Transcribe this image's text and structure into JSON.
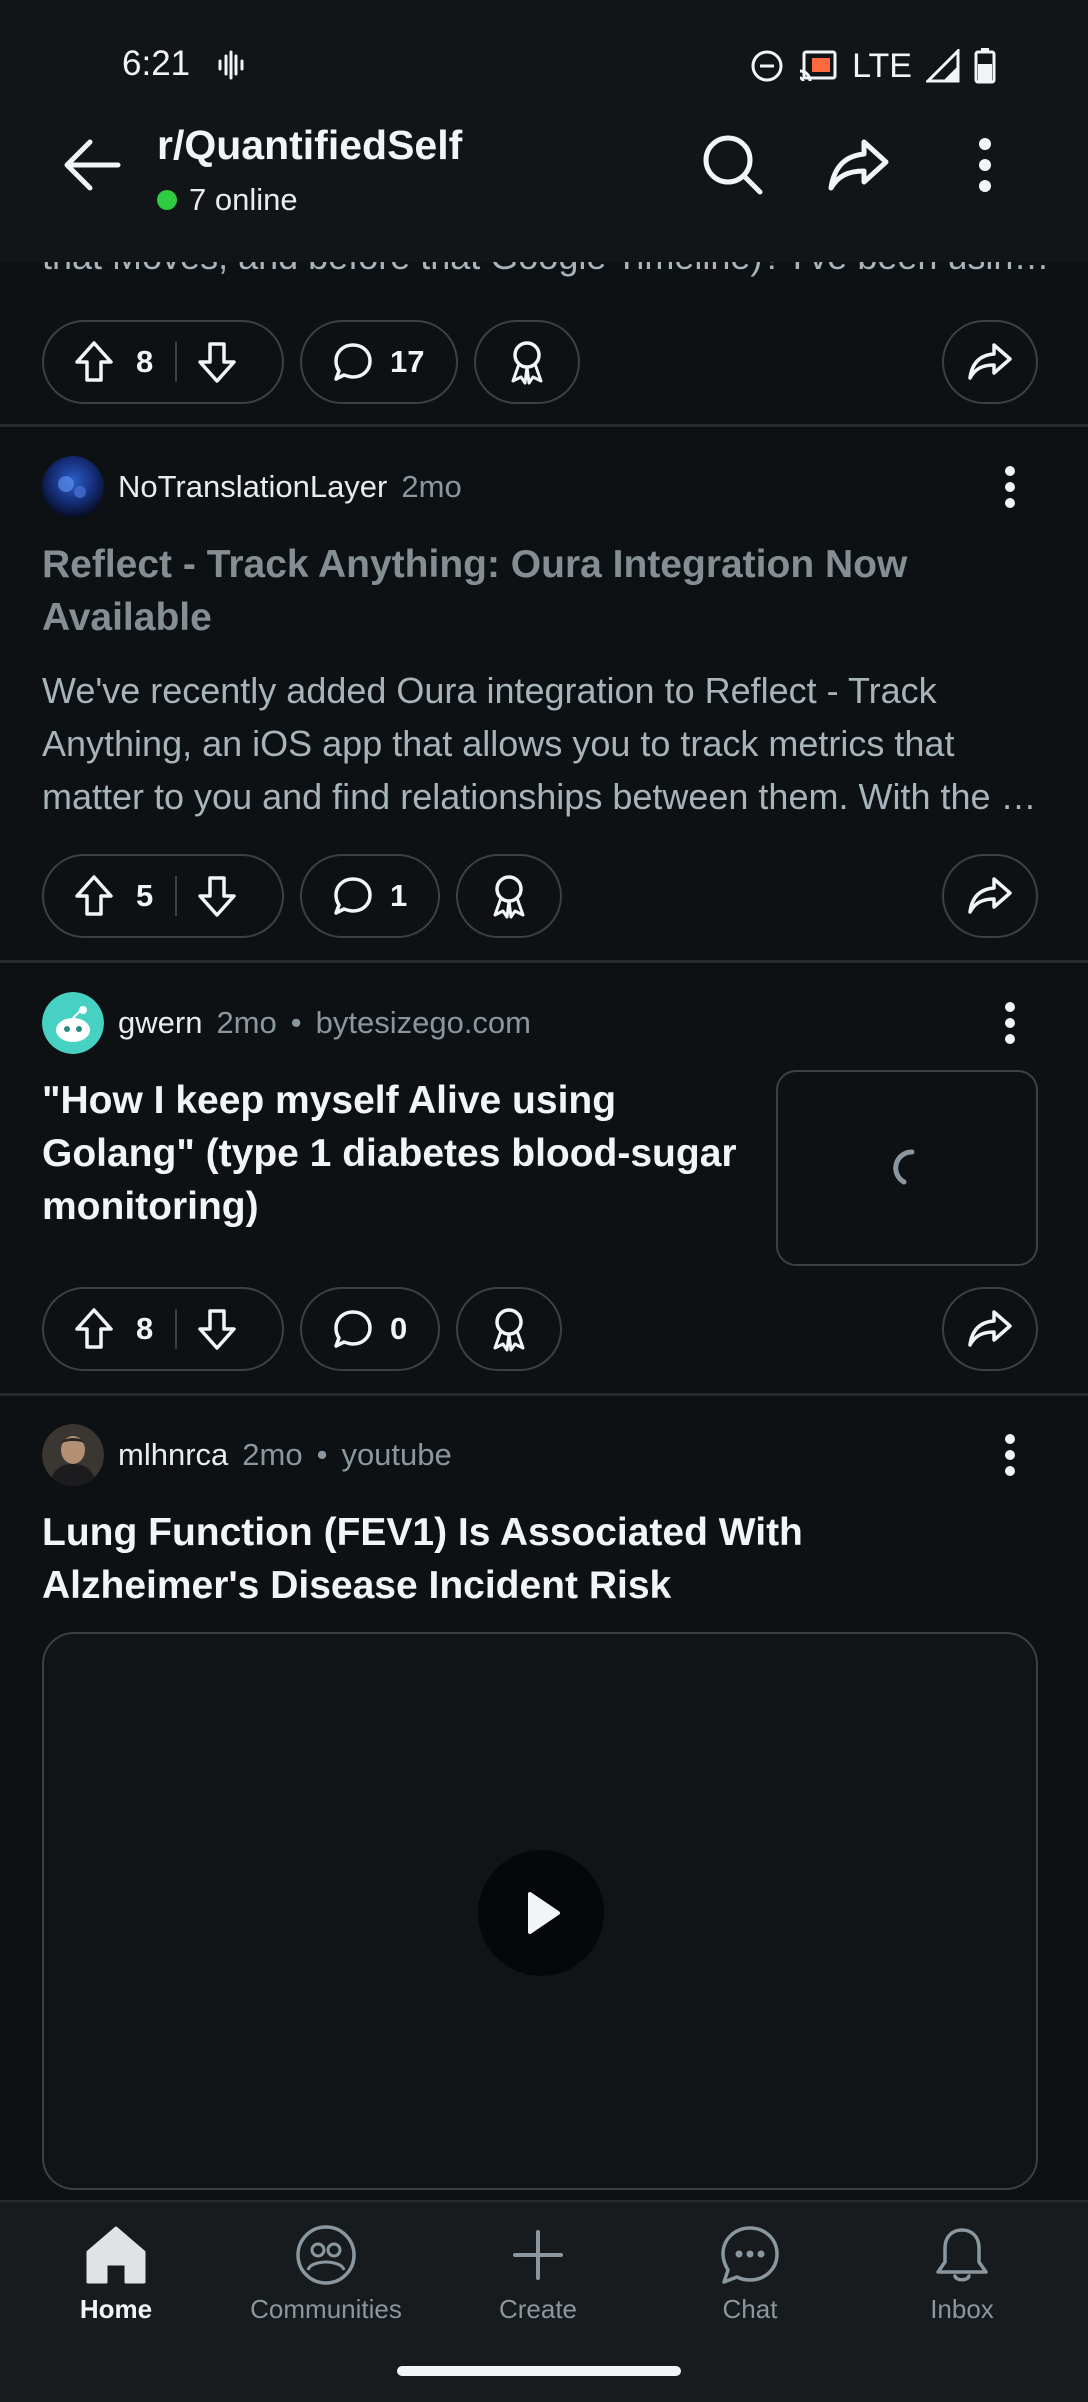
{
  "status_bar": {
    "time": "6:21",
    "network": "LTE"
  },
  "header": {
    "subreddit": "r/QuantifiedSelf",
    "online_text": "7 online",
    "online_color": "#2ecc40",
    "icons": [
      "back-arrow-icon",
      "search-icon",
      "share-icon",
      "more-vertical-icon"
    ]
  },
  "feed": {
    "prev_snippet": "that Moves, and before that Google Timeline)? I've been usin…",
    "prev_actions": {
      "upvotes": "8",
      "comments": "17"
    },
    "posts": [
      {
        "author": "NoTranslationLayer",
        "age": "2mo",
        "title_line1": "Reflect - Track Anything: Oura Integration Now",
        "title_line2": "Available",
        "body_line1": "We've recently added Oura integration to Reflect - Track",
        "body_line2": "Anything, an iOS app that allows you to track metrics that",
        "body_line3": "matter to you and find relationships between them. With the …",
        "upvotes": "5",
        "comments": "1"
      },
      {
        "author": "gwern",
        "age": "2mo",
        "domain": "bytesizego.com",
        "title_line1": "\"How I keep myself Alive using",
        "title_line2": "Golang\" (type 1 diabetes blood-sugar",
        "title_line3": "monitoring)",
        "upvotes": "8",
        "comments": "0"
      },
      {
        "author": "mlhnrca",
        "age": "2mo",
        "domain": "youtube",
        "title_line1": "Lung Function (FEV1) Is Associated With",
        "title_line2": "Alzheimer's Disease Incident Risk"
      }
    ]
  },
  "bottom_nav": {
    "items": [
      {
        "label": "Home",
        "icon": "home-icon"
      },
      {
        "label": "Communities",
        "icon": "communities-icon"
      },
      {
        "label": "Create",
        "icon": "plus-icon"
      },
      {
        "label": "Chat",
        "icon": "chat-icon"
      },
      {
        "label": "Inbox",
        "icon": "bell-icon"
      }
    ],
    "active": "Home"
  }
}
